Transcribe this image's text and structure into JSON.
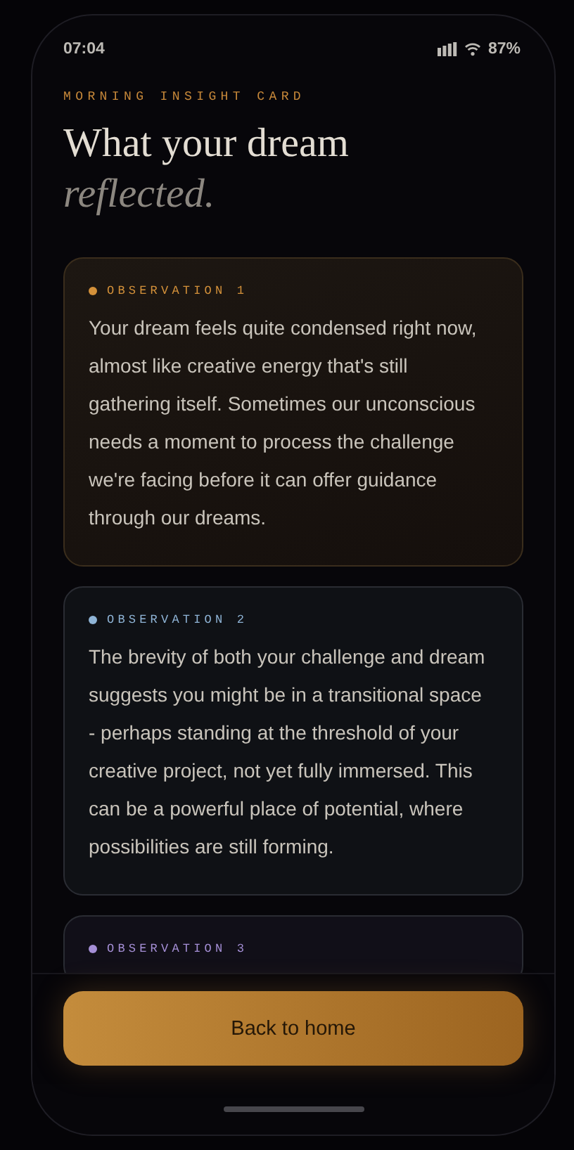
{
  "status_bar": {
    "time": "07:04",
    "battery": "87%"
  },
  "eyebrow": "MORNING INSIGHT CARD",
  "title": {
    "line1": "What your dream",
    "line2": "reflected."
  },
  "observations": [
    {
      "label": "OBSERVATION 1",
      "color": "#d4913a",
      "text": "Your dream feels quite condensed right now, almost like creative energy that's still gathering itself. Sometimes our unconscious needs a moment to process the challenge we're facing before it can offer guidance through our dreams."
    },
    {
      "label": "OBSERVATION 2",
      "color": "#8fb4d6",
      "text": "The brevity of both your challenge and dream suggests you might be in a transitional space - perhaps standing at the threshold of your creative project, not yet fully immersed. This can be a powerful place of potential, where possibilities are still forming."
    },
    {
      "label": "OBSERVATION 3",
      "color": "#a58fd6"
    }
  ],
  "button": "Back to home"
}
